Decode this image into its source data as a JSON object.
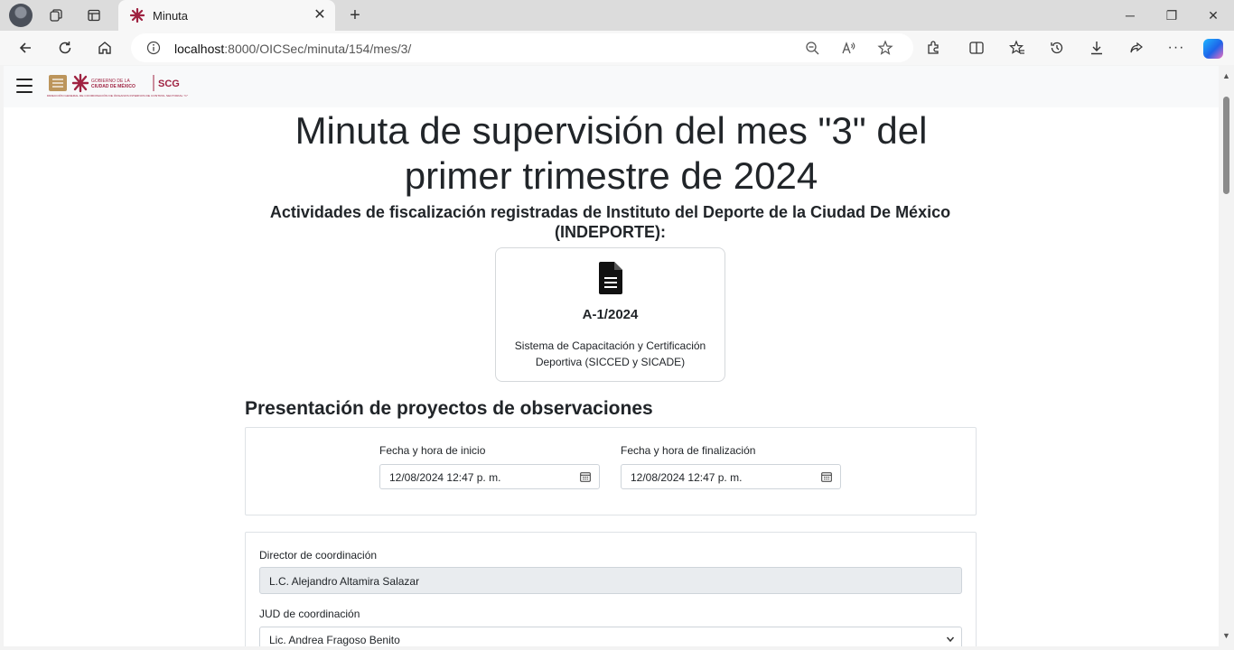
{
  "browser": {
    "tab_title": "Minuta",
    "url_host": "localhost",
    "url_rest": ":8000/OICSec/minuta/154/mes/3/"
  },
  "page": {
    "title": "Minuta de supervisión del mes \"3\" del primer trimestre de 2024",
    "subtitle": "Actividades de fiscalización registradas de Instituto del Deporte de la Ciudad De México (INDEPORTE):",
    "activity_card": {
      "code": "A-1/2024",
      "description": "Sistema de Capacitación y Certificación Deportiva (SICCED y SICADE)",
      "icon": "file-text-icon"
    },
    "section_title": "Presentación de proyectos de observaciones",
    "start_label": "Fecha y hora de inicio",
    "start_value": "12/08/2024 12:47 p. m.",
    "end_label": "Fecha y hora de finalización",
    "end_value": "12/08/2024 12:47 p. m.",
    "director_label": "Director de coordinación",
    "director_value": "L.C. Alejandro Altamira Salazar",
    "jud_label": "JUD de coordinación",
    "jud_value": "Lic. Andrea Fragoso Benito"
  },
  "logo": {
    "brand": "SCG",
    "gov_line1": "GOBIERNO DE LA",
    "gov_line2": "CIUDAD DE MÉXICO",
    "tagline": "DIRECCIÓN GENERAL DE COORDINACIÓN DE ÓRGANOS INTERNOS DE CONTROL SECTORIAL \"C\""
  },
  "colors": {
    "accent": "#9f2241",
    "gold": "#bc955c"
  }
}
